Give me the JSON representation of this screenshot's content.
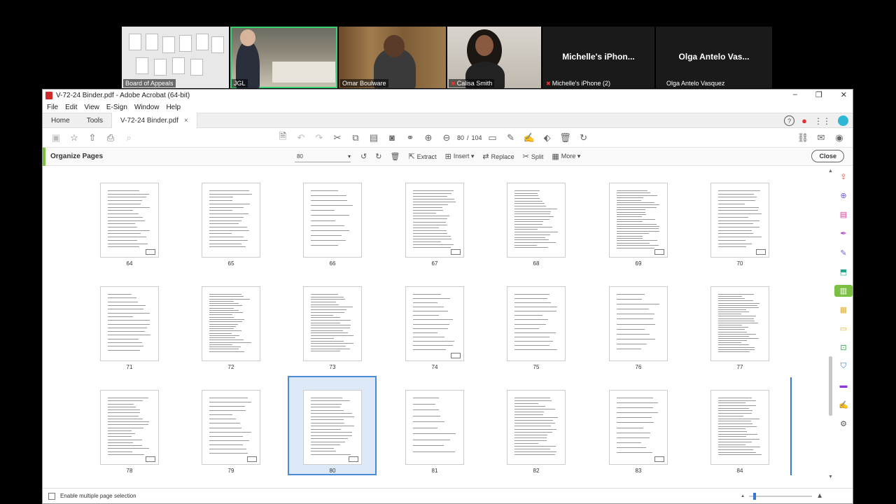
{
  "participants": [
    {
      "name": "Board of Appeals",
      "muted": false,
      "active": false,
      "scene": "doc"
    },
    {
      "name": "JGL",
      "muted": false,
      "active": true,
      "scene": "room"
    },
    {
      "name": "Omar Boulware",
      "muted": false,
      "active": false,
      "scene": "shelf"
    },
    {
      "name": "Calisa Smith",
      "muted": true,
      "active": false,
      "scene": "wall"
    },
    {
      "name": "Michelle's iPhone (2)",
      "big_name": "Michelle's iPhon...",
      "muted": true,
      "active": false,
      "scene": "dark"
    },
    {
      "name": "Olga Antelo Vasquez",
      "big_name": "Olga Antelo Vas...",
      "muted": false,
      "active": false,
      "scene": "dark"
    }
  ],
  "window": {
    "title": "V-72-24 Binder.pdf - Adobe Acrobat (64-bit)",
    "minimize": "–",
    "restore": "❐",
    "close": "✕"
  },
  "menu": [
    "File",
    "Edit",
    "View",
    "E-Sign",
    "Window",
    "Help"
  ],
  "tabs": {
    "home": "Home",
    "tools": "Tools",
    "doc": "V-72-24 Binder.pdf",
    "doc_close": "×"
  },
  "toolbar": {
    "current_page": "80",
    "separator": "/",
    "total_pages": "104"
  },
  "organize": {
    "title": "Organize Pages",
    "page_field": "80",
    "extract": "Extract",
    "insert": "Insert ▾",
    "replace": "Replace",
    "split": "Split",
    "more": "More ▾",
    "close": "Close"
  },
  "thumbnails": {
    "rows": [
      [
        "64",
        "65",
        "66",
        "67",
        "68",
        "69",
        "70"
      ],
      [
        "71",
        "72",
        "73",
        "74",
        "75",
        "76",
        "77"
      ],
      [
        "78",
        "79",
        "80",
        "81",
        "82",
        "83",
        "84"
      ]
    ],
    "selected": "80"
  },
  "footer": {
    "checkbox_label": "Enable multiple page selection",
    "zoom_out": "▲",
    "zoom_in": "▲"
  },
  "colors": {
    "accent_green": "#7bc043",
    "selection_blue": "#4a8ad6",
    "acrobat_red": "#d02b2b"
  }
}
